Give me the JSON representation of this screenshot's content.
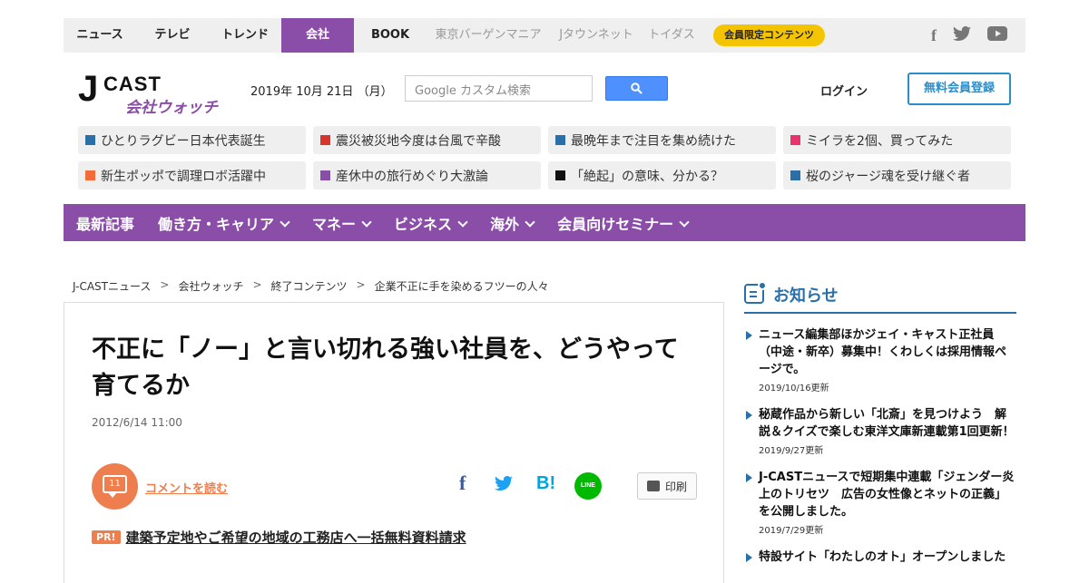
{
  "topnav": {
    "items": [
      {
        "label": "ニュース",
        "state": "normal"
      },
      {
        "label": "テレビ",
        "state": "normal"
      },
      {
        "label": "トレンド",
        "state": "normal"
      },
      {
        "label": "会社",
        "state": "active"
      },
      {
        "label": "BOOK",
        "state": "normal"
      },
      {
        "label": "東京バーゲンマニア",
        "state": "dim"
      },
      {
        "label": "Jタウンネット",
        "state": "dim"
      },
      {
        "label": "トイダス",
        "state": "dim"
      }
    ],
    "members_badge": "会員限定コンテンツ",
    "social": [
      "facebook-icon",
      "twitter-icon",
      "youtube-icon"
    ]
  },
  "header": {
    "logo_main": "CAST",
    "logo_j": "J",
    "logo_sub": "会社ウォッチ",
    "date": "2019年 10月 21日 （月）",
    "search_placeholder": "Google カスタム検索",
    "login": "ログイン",
    "register": "無料会員登録"
  },
  "topics": [
    {
      "label": "ひとりラグビー日本代表誕生",
      "color": "#2a6fa8"
    },
    {
      "label": "震災被災地今度は台風で辛酸",
      "color": "#d9342b"
    },
    {
      "label": "最晩年まで注目を集め続けた",
      "color": "#2a6fa8"
    },
    {
      "label": "ミイラを2個、買ってみた",
      "color": "#e8336f"
    },
    {
      "label": "新生ポッポで調理ロボ活躍中",
      "color": "#f26b3a"
    },
    {
      "label": "産休中の旅行めぐり大激論",
      "color": "#8a4ea8"
    },
    {
      "label": "「絶起」の意味、分かる？",
      "color": "#111111"
    },
    {
      "label": "桜のジャージ魂を受け継ぐ者",
      "color": "#2a6fa8"
    }
  ],
  "mainnav": [
    {
      "label": "最新記事",
      "dropdown": false
    },
    {
      "label": "働き方・キャリア",
      "dropdown": true
    },
    {
      "label": "マネー",
      "dropdown": true
    },
    {
      "label": "ビジネス",
      "dropdown": true
    },
    {
      "label": "海外",
      "dropdown": true
    },
    {
      "label": "会員向けセミナー",
      "dropdown": true
    }
  ],
  "breadcrumb": [
    "J-CASTニュース",
    "会社ウォッチ",
    "終了コンテンツ",
    "企業不正に手を染めるフツーの人々"
  ],
  "breadcrumb_sep": ">",
  "article": {
    "title": "不正に「ノー」と言い切れる強い社員を、どうやって育てるか",
    "date": "2012/6/14 11:00",
    "comment_count": "11",
    "comment_link": "コメントを読む",
    "share": {
      "facebook": "f",
      "hatena": "B!",
      "line": "LINE"
    },
    "print": "印刷",
    "pr_badge": "PR!",
    "pr_link": "建築予定地やご希望の地域の工務店へ一括無料資料請求"
  },
  "sidebar": {
    "title": "お知らせ",
    "notices": [
      {
        "text": "ニュース編集部ほかジェイ・キャスト正社員（中途・新卒）募集中！くわしくは採用情報ページで。",
        "date": "2019/10/16更新"
      },
      {
        "text": "秘蔵作品から新しい「北斎」を見つけよう　解説＆クイズで楽しむ東洋文庫新連載第1回更新！",
        "date": "2019/9/27更新"
      },
      {
        "text": "J-CASTニュースで短期集中連載「ジェンダー炎上のトリセツ　広告の女性像とネットの正義」を公開しました。",
        "date": "2019/7/29更新"
      },
      {
        "text": "特設サイト「わたしのオト」オープンしました",
        "date": ""
      }
    ]
  },
  "colors": {
    "brand_purple": "#8a4ea8",
    "accent_blue": "#2a6fa8",
    "comment_orange": "#ee7e4e"
  }
}
